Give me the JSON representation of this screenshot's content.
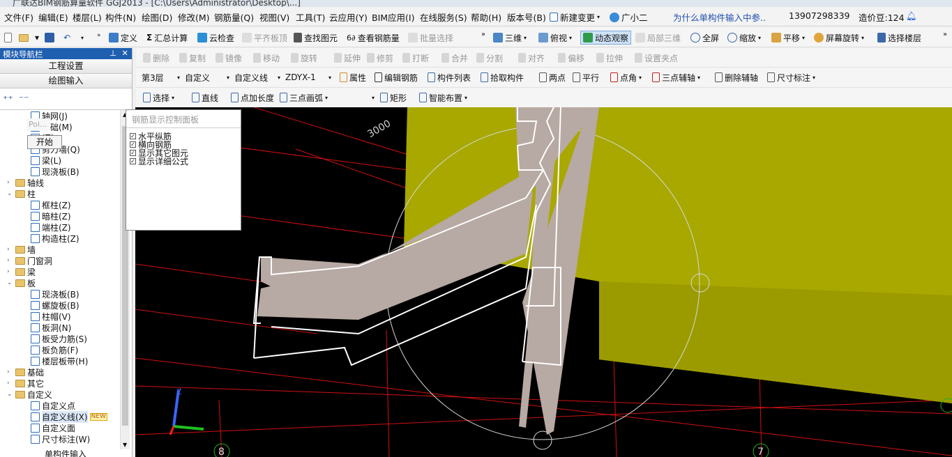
{
  "window": {
    "title": "广联达BIM钢筋算量软件 GGJ2013 - [C:\\Users\\Administrator\\Desktop\\...]"
  },
  "menu": [
    "文件(F)",
    "编辑(E)",
    "楼层(L)",
    "构件(N)",
    "绘图(D)",
    "修改(M)",
    "钢筋量(Q)",
    "视图(V)",
    "工具(T)",
    "云应用(Y)",
    "BIM应用(I)",
    "在线服务(S)",
    "帮助(H)",
    "版本号(B)"
  ],
  "menu_right": {
    "new_change": "新建变更",
    "assistant": "广小二",
    "question_link": "为什么单构件输入中参..",
    "phone": "13907298339",
    "cost_beans": "造价豆:124"
  },
  "toolbar1": {
    "items": [
      "定义",
      "汇总计算",
      "云检查",
      "平齐板顶",
      "查找图元",
      "查看钢筋量",
      "批量选择"
    ],
    "right_items": [
      "三维",
      "俯视",
      "动态观察",
      "局部三维",
      "全屏",
      "缩放",
      "平移",
      "屏幕旋转",
      "选择楼层"
    ]
  },
  "toolbar2": {
    "items": [
      "删除",
      "复制",
      "镜像",
      "移动",
      "旋转",
      "延伸",
      "修剪",
      "打断",
      "合并",
      "分割",
      "对齐",
      "偏移",
      "拉伸",
      "设置夹点"
    ]
  },
  "toolbar3": {
    "floor": "第3层",
    "category": "自定义",
    "type": "自定义线",
    "component": "ZDYX-1",
    "items": [
      "属性",
      "编辑钢筋",
      "构件列表",
      "拾取构件",
      "两点",
      "平行",
      "点角",
      "三点辅轴",
      "删除辅轴",
      "尺寸标注"
    ]
  },
  "toolbar4": {
    "items": [
      "选择",
      "直线",
      "点加长度",
      "三点画弧",
      "矩形",
      "智能布置"
    ]
  },
  "nav": {
    "title": "模块导航栏",
    "buttons": [
      "工程设置",
      "绘图输入"
    ],
    "tree": [
      {
        "label": "轴网(J)",
        "level": 2,
        "type": "leaf"
      },
      {
        "label": "基础(M)",
        "level": 2,
        "type": "leaf"
      },
      {
        "label": "(Z)",
        "level": 2,
        "type": "leaf"
      },
      {
        "label": "剪力墙(Q)",
        "level": 2,
        "type": "leaf"
      },
      {
        "label": "梁(L)",
        "level": 2,
        "type": "leaf"
      },
      {
        "label": "现浇板(B)",
        "level": 2,
        "type": "leaf"
      },
      {
        "label": "轴线",
        "level": 1,
        "type": "folder",
        "expanded": false
      },
      {
        "label": "柱",
        "level": 1,
        "type": "folder",
        "expanded": true
      },
      {
        "label": "框柱(Z)",
        "level": 2,
        "type": "leaf"
      },
      {
        "label": "暗柱(Z)",
        "level": 2,
        "type": "leaf"
      },
      {
        "label": "端柱(Z)",
        "level": 2,
        "type": "leaf"
      },
      {
        "label": "构造柱(Z)",
        "level": 2,
        "type": "leaf"
      },
      {
        "label": "墙",
        "level": 1,
        "type": "folder",
        "expanded": false
      },
      {
        "label": "门窗洞",
        "level": 1,
        "type": "folder",
        "expanded": false
      },
      {
        "label": "梁",
        "level": 1,
        "type": "folder",
        "expanded": false
      },
      {
        "label": "板",
        "level": 1,
        "type": "folder",
        "expanded": true
      },
      {
        "label": "现浇板(B)",
        "level": 2,
        "type": "leaf"
      },
      {
        "label": "螺旋板(B)",
        "level": 2,
        "type": "leaf"
      },
      {
        "label": "柱帽(V)",
        "level": 2,
        "type": "leaf"
      },
      {
        "label": "板洞(N)",
        "level": 2,
        "type": "leaf"
      },
      {
        "label": "板受力筋(S)",
        "level": 2,
        "type": "leaf"
      },
      {
        "label": "板负筋(F)",
        "level": 2,
        "type": "leaf"
      },
      {
        "label": "楼层板带(H)",
        "level": 2,
        "type": "leaf"
      },
      {
        "label": "基础",
        "level": 1,
        "type": "folder",
        "expanded": false
      },
      {
        "label": "其它",
        "level": 1,
        "type": "folder",
        "expanded": false
      },
      {
        "label": "自定义",
        "level": 1,
        "type": "folder",
        "expanded": true
      },
      {
        "label": "自定义点",
        "level": 2,
        "type": "leaf"
      },
      {
        "label": "自定义线(X)",
        "level": 2,
        "type": "leaf",
        "badge": "NEW"
      },
      {
        "label": "自定义面",
        "level": 2,
        "type": "leaf"
      },
      {
        "label": "尺寸标注(W)",
        "level": 2,
        "type": "leaf"
      }
    ],
    "bottom_item": "单构件输入"
  },
  "popups": {
    "poi": "Poi...",
    "start": "开始"
  },
  "rebar_panel": {
    "title": "钢筋显示控制面板",
    "options": [
      {
        "label": "水平纵筋",
        "checked": true
      },
      {
        "label": "横向钢筋",
        "checked": true
      },
      {
        "label": "显示其它图元",
        "checked": true
      },
      {
        "label": "显示详细公式",
        "checked": true
      }
    ]
  },
  "canvas": {
    "dimension_label": "3000",
    "axis_labels": [
      "8",
      "7"
    ],
    "axis_names": [
      "Z"
    ],
    "colors": {
      "background": "#000000",
      "wall": "#a8a800",
      "grid": "#d01010",
      "rebar": "#b7a9a3",
      "outline": "#ffffff"
    }
  }
}
